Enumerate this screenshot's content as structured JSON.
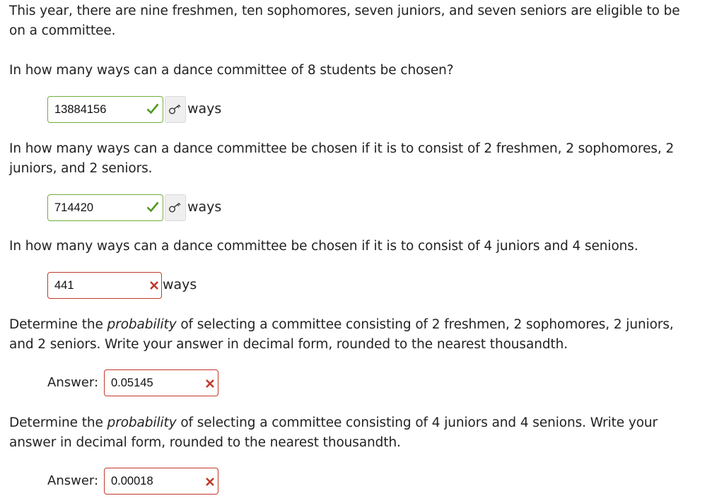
{
  "intro": "This year, there are nine freshmen, ten sophomores, seven juniors, and seven seniors are eligible to be on a committee.",
  "questions": [
    {
      "prompt": "In how many ways can a dance committee of 8 students be chosen?",
      "answer": "13884156",
      "status": "correct",
      "unit": "ways"
    },
    {
      "prompt": "In how many ways can a dance committee be chosen if it is to consist of 2 freshmen, 2 sophomores, 2 juniors, and 2 seniors.",
      "answer": "714420",
      "status": "correct",
      "unit": "ways"
    },
    {
      "prompt": "In how many ways can a dance committee be chosen if it is to consist of 4 juniors and 4 senions.",
      "answer": "441",
      "status": "incorrect",
      "unit": "ways"
    }
  ],
  "prob_questions": [
    {
      "prompt_before": "Determine the ",
      "prompt_em": "probability",
      "prompt_after": " of selecting a committee consisting of 2 freshmen, 2 sophomores, 2 juniors, and 2 seniors. Write your answer in decimal form, rounded to the nearest thousandth.",
      "answer_label": "Answer:",
      "answer": "0.05145",
      "status": "incorrect"
    },
    {
      "prompt_before": "Determine the ",
      "prompt_em": "probability",
      "prompt_after": " of selecting a committee consisting of 4 juniors and 4 senions. Write your answer in decimal form, rounded to the nearest thousandth.",
      "answer_label": "Answer:",
      "answer": "0.00018",
      "status": "incorrect"
    }
  ],
  "icons": {
    "correct": "check-icon",
    "incorrect": "cross-icon",
    "key": "key-icon"
  },
  "colors": {
    "correct": "#4e9a1f",
    "incorrect": "#c0392b",
    "correct_border": "#6fae3d"
  }
}
